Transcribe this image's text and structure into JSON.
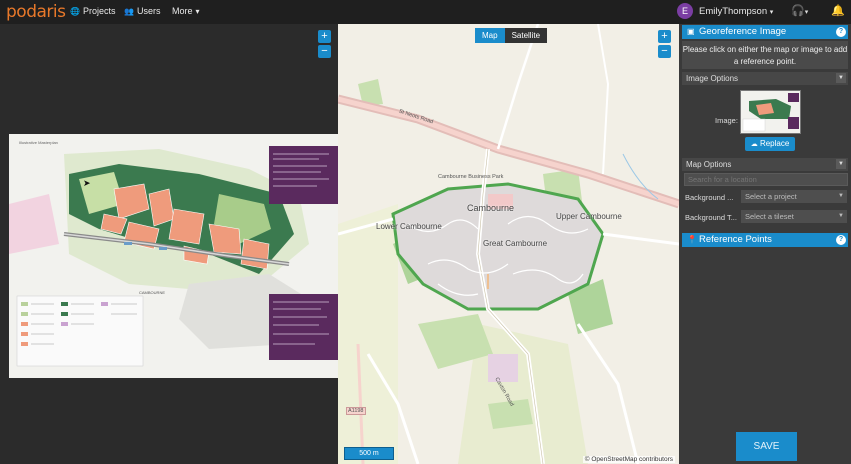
{
  "app": {
    "logo": "podaris"
  },
  "nav": [
    {
      "label": "Projects",
      "icon": "globe-icon"
    },
    {
      "label": "Users",
      "icon": "users-icon"
    },
    {
      "label": "More",
      "icon": "chevron-down-icon"
    }
  ],
  "user": {
    "initial": "E",
    "name": "EmilyThompson"
  },
  "map": {
    "toggle_map": "Map",
    "toggle_satellite": "Satellite",
    "scale": "500 m",
    "attribution": "© OpenStreetMap contributors",
    "labels": {
      "cambourne": "Cambourne",
      "upper": "Upper Cambourne",
      "lower": "Lower Cambourne",
      "great": "Great Cambourne",
      "cambourne_business": "Cambourne Business Park",
      "a1198": "A1198",
      "st_neots": "St Neots Road",
      "caxton_road": "Caxton Road"
    }
  },
  "panel": {
    "georef_title": "Georeference Image",
    "help": "?",
    "info": "Please click on either the map or image to add a reference point.",
    "image_options": "Image Options",
    "image_label": "Image:",
    "replace": "Replace",
    "map_options": "Map Options",
    "search_placeholder": "Search for a location",
    "bg_project_label": "Background ...",
    "bg_project_value": "Select a project",
    "bg_tileset_label": "Background T...",
    "bg_tileset_value": "Select a tileset",
    "ref_points": "Reference Points",
    "save": "SAVE"
  },
  "zoom": {
    "plus": "+",
    "minus": "−"
  }
}
